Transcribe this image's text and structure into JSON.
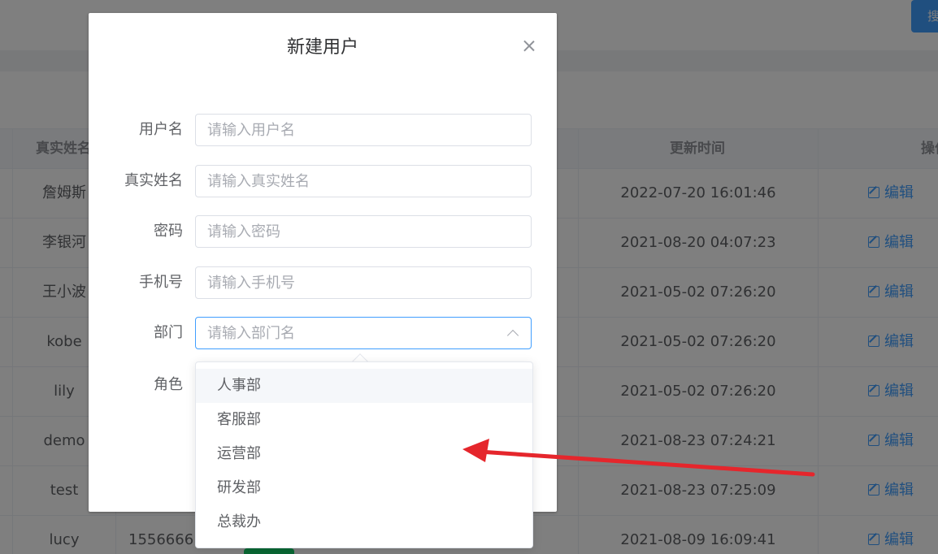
{
  "background": {
    "search_button_label": "搜",
    "columns": {
      "real_name": "真实姓名",
      "updated_time": "更新时间",
      "actions": "操作"
    },
    "rows": [
      {
        "name": "詹姆斯",
        "phone": "",
        "updated": "2022-07-20 16:01:46",
        "edit": "编辑"
      },
      {
        "name": "李银河",
        "phone": "",
        "updated": "2021-08-20 04:07:23",
        "edit": "编辑"
      },
      {
        "name": "王小波",
        "phone": "",
        "updated": "2021-05-02 07:26:20",
        "edit": "编辑"
      },
      {
        "name": "kobe",
        "phone": "",
        "updated": "2021-05-02 07:26:20",
        "edit": "编辑"
      },
      {
        "name": "lily",
        "phone": "",
        "updated": "2021-05-02 07:26:20",
        "edit": "编辑"
      },
      {
        "name": "demo",
        "phone": "",
        "updated": "2021-08-23 07:24:21",
        "edit": "编辑"
      },
      {
        "name": "test",
        "phone": "",
        "updated": "2021-08-23 07:25:09",
        "edit": "编辑"
      },
      {
        "name": "lucy",
        "phone": "1556666...",
        "updated": "2021-08-09 16:09:41",
        "edit": "编辑"
      }
    ]
  },
  "dialog": {
    "title": "新建用户",
    "fields": [
      {
        "label": "用户名",
        "placeholder": "请输入用户名"
      },
      {
        "label": "真实姓名",
        "placeholder": "请输入真实姓名"
      },
      {
        "label": "密码",
        "placeholder": "请输入密码"
      },
      {
        "label": "手机号",
        "placeholder": "请输入手机号"
      },
      {
        "label": "部门",
        "placeholder": "请输入部门名"
      }
    ],
    "role_label": "角色",
    "department_options": [
      "人事部",
      "客服部",
      "运营部",
      "研发部",
      "总裁办"
    ]
  },
  "colors": {
    "primary": "#409eff",
    "annotation": "#e5262c",
    "mask": "rgba(0,0,0,0.5)"
  },
  "icons": [
    "close-icon",
    "chevron-up-icon",
    "edit-icon",
    "red-arrow"
  ]
}
